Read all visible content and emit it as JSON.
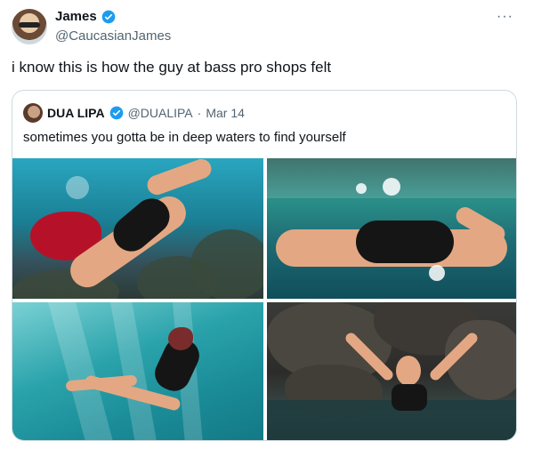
{
  "tweet": {
    "name": "James",
    "handle": "@CaucasianJames",
    "more_label": "···",
    "text": "i know this is how the guy at bass pro shops felt"
  },
  "quote": {
    "name": "DUA LIPA",
    "handle": "@DUALIPA",
    "separator": "·",
    "date": "Mar 14",
    "text": "sometimes you gotta be in deep waters to find yourself"
  },
  "colors": {
    "verified": "#1d9bf0",
    "secondary_text": "#536471",
    "border": "#cfd9de"
  }
}
